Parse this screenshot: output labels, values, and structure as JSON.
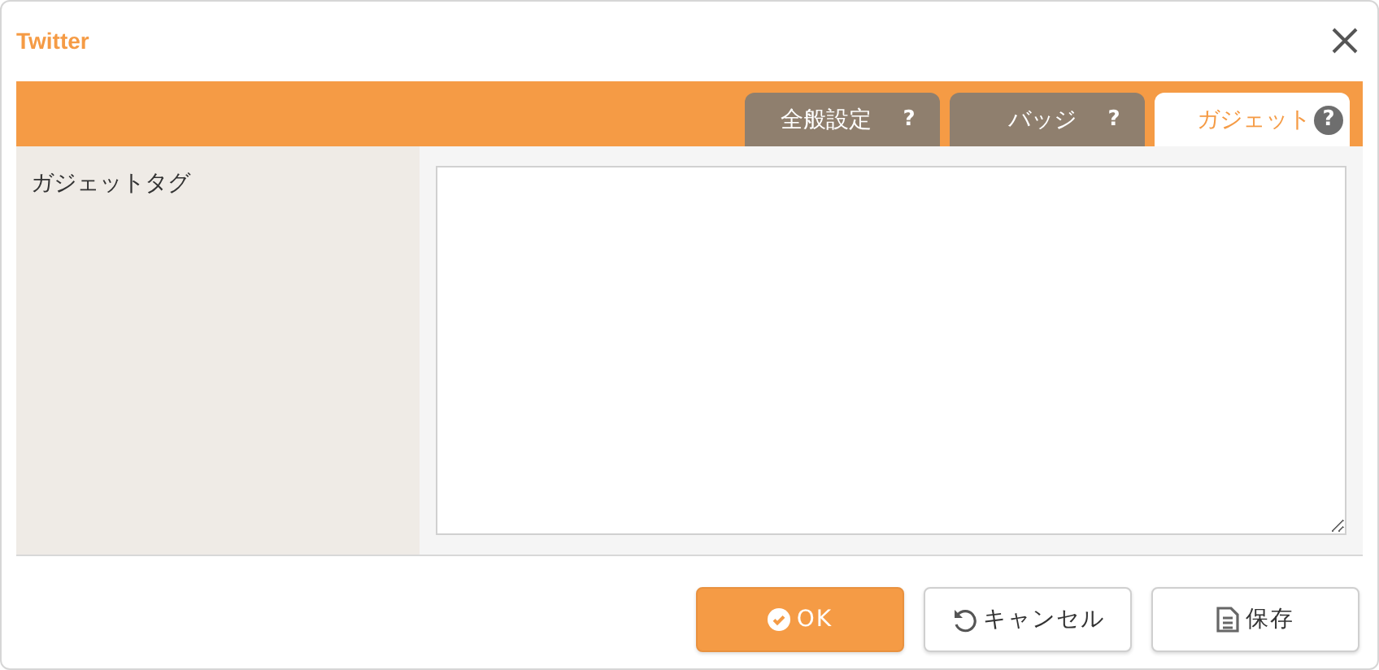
{
  "window": {
    "title": "Twitter"
  },
  "tabs": [
    {
      "label": "全般設定",
      "help": "?",
      "selected": false
    },
    {
      "label": "バッジ",
      "help": "?",
      "selected": false
    },
    {
      "label": "ガジェット",
      "help": "?",
      "selected": true
    }
  ],
  "form": {
    "label": "ガジェットタグ"
  },
  "buttons": [
    {
      "kind": "ok",
      "label": "OK"
    },
    {
      "kind": "cancel",
      "label": "キャンセル"
    },
    {
      "kind": "save",
      "label": "保存"
    }
  ]
}
